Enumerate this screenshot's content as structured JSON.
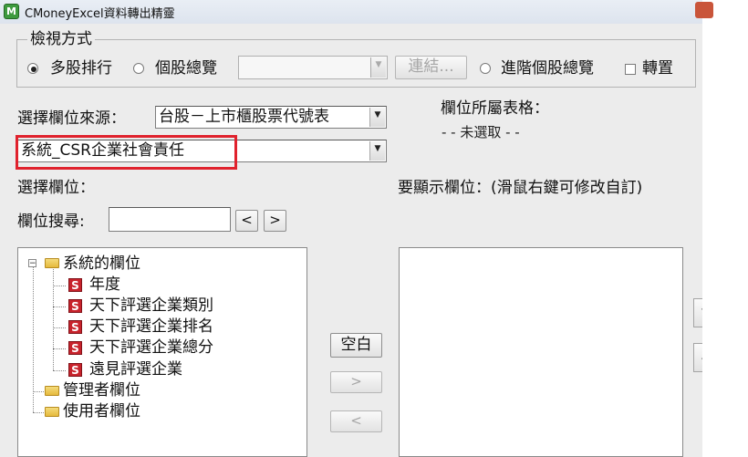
{
  "window": {
    "title": "CMoneyExcel資料轉出精靈",
    "icon_letter": "M"
  },
  "view_mode": {
    "legend": "檢視方式",
    "options": {
      "multi_rank": "多股排行",
      "single_overview": "個股總覽",
      "advanced_overview": "進階個股總覽"
    },
    "selected": "multi_rank",
    "stock_input": {
      "value": ""
    },
    "link_button": "連結...",
    "transpose_label": "轉置",
    "transpose_checked": false
  },
  "source": {
    "label": "選擇欄位來源：",
    "value": "台股－上市櫃股票代號表",
    "category_value": "系統_CSR企業社會責任"
  },
  "table_info": {
    "label": "欄位所屬表格：",
    "value": "- - 未選取 - -"
  },
  "field_select": {
    "label": "選擇欄位：",
    "search_label": "欄位搜尋:",
    "search_value": "",
    "prev": "<",
    "next": ">"
  },
  "display_fields": {
    "label": "要顯示欄位：(滑鼠右鍵可修改自訂)"
  },
  "tree": {
    "root": "系統的欄位",
    "children": [
      "年度",
      "天下評選企業類別",
      "天下評選企業排名",
      "天下評選企業總分",
      "遠見評選企業"
    ],
    "s_icon": "S",
    "others": [
      "管理者欄位",
      "使用者欄位"
    ]
  },
  "buttons": {
    "blank": "空白",
    "add": ">",
    "remove": "<"
  },
  "move": {
    "up": "↑",
    "down": "↓"
  },
  "colors": {
    "highlight": "#e0222d",
    "s_icon": "#c8232c",
    "folder": "#e5b93c"
  }
}
